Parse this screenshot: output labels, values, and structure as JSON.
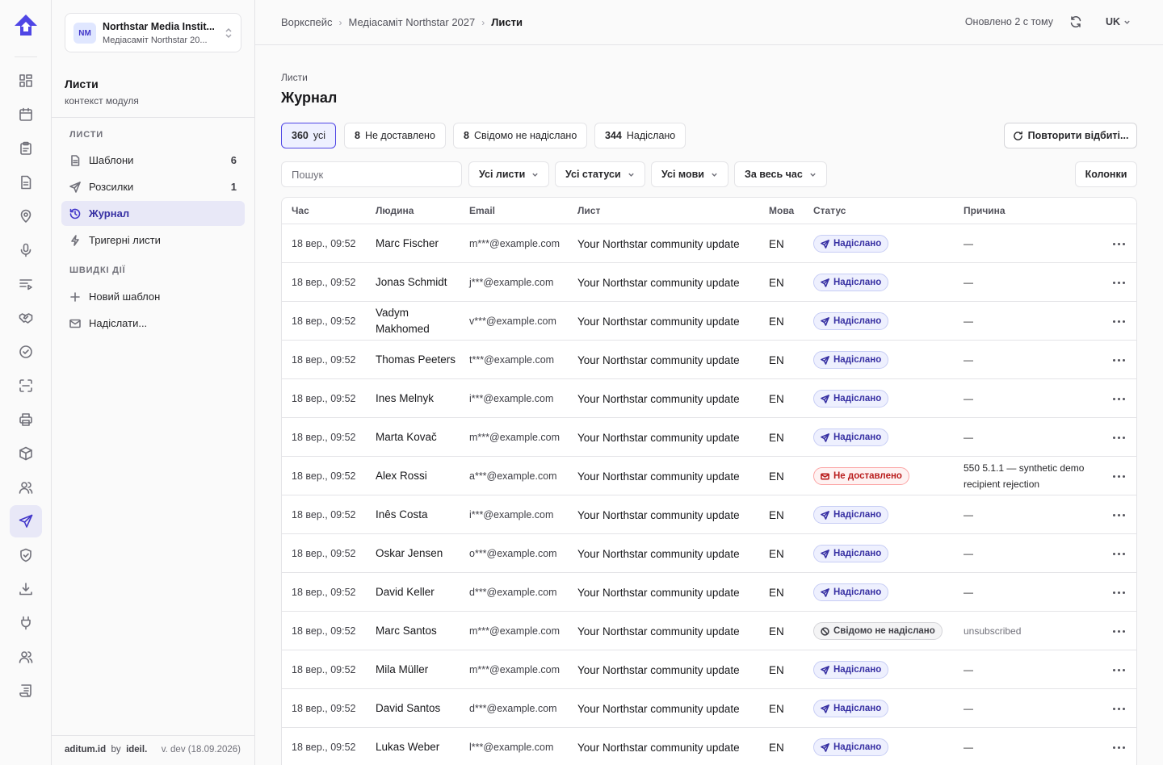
{
  "topbar": {
    "breadcrumbs": [
      "Воркспейс",
      "Медіасаміт Northstar 2027",
      "Листи"
    ],
    "updated": "Оновлено 2 с тому",
    "language": "UK"
  },
  "org": {
    "initials": "NM",
    "name": "Northstar Media Instit...",
    "event": "Медіасаміт Northstar 20..."
  },
  "module": {
    "title": "Листи",
    "subtitle": "контекст модуля"
  },
  "sidebar": {
    "section_letters": "ЛИСТИ",
    "items": [
      {
        "label": "Шаблони",
        "count": "6",
        "icon": "file-icon"
      },
      {
        "label": "Розсилки",
        "count": "1",
        "icon": "send-icon"
      },
      {
        "label": "Журнал",
        "count": "",
        "icon": "history-icon"
      },
      {
        "label": "Тригерні листи",
        "count": "",
        "icon": "bolt-icon"
      }
    ],
    "section_quick": "ШВИДКІ ДІЇ",
    "quick": [
      {
        "label": "Новий шаблон",
        "icon": "plus-icon"
      },
      {
        "label": "Надіслати...",
        "icon": "mail-icon"
      }
    ],
    "footer": {
      "brand": "aditum.id",
      "by": "by",
      "company": "ideil.",
      "version": "v. dev (18.09.2026)"
    }
  },
  "page": {
    "crumb": "Листи",
    "title": "Журнал",
    "filters": [
      {
        "count": "360",
        "label": "усі"
      },
      {
        "count": "8",
        "label": "Не доставлено"
      },
      {
        "count": "8",
        "label": "Свідомо не надіслано"
      },
      {
        "count": "344",
        "label": "Надіслано"
      }
    ],
    "retry_label": "Повторити відбиті...",
    "search_placeholder": "Пошук",
    "dropdowns": [
      "Усі листи",
      "Усі статуси",
      "Усі мови",
      "За весь час"
    ],
    "columns_label": "Колонки"
  },
  "table": {
    "headers": [
      "Час",
      "Людина",
      "Email",
      "Лист",
      "Мова",
      "Статус",
      "Причина"
    ],
    "rows": [
      {
        "time": "18 вер., 09:52",
        "person": "Marc Fischer",
        "email": "m***@example.com",
        "letter": "Your Northstar community update",
        "lang": "EN",
        "status": "Надіслано",
        "kind": "sent",
        "reason": "—"
      },
      {
        "time": "18 вер., 09:52",
        "person": "Jonas Schmidt",
        "email": "j***@example.com",
        "letter": "Your Northstar community update",
        "lang": "EN",
        "status": "Надіслано",
        "kind": "sent",
        "reason": "—"
      },
      {
        "time": "18 вер., 09:52",
        "person": "Vadym Makhomed",
        "email": "v***@example.com",
        "letter": "Your Northstar community update",
        "lang": "EN",
        "status": "Надіслано",
        "kind": "sent",
        "reason": "—"
      },
      {
        "time": "18 вер., 09:52",
        "person": "Thomas Peeters",
        "email": "t***@example.com",
        "letter": "Your Northstar community update",
        "lang": "EN",
        "status": "Надіслано",
        "kind": "sent",
        "reason": "—"
      },
      {
        "time": "18 вер., 09:52",
        "person": "Ines Melnyk",
        "email": "i***@example.com",
        "letter": "Your Northstar community update",
        "lang": "EN",
        "status": "Надіслано",
        "kind": "sent",
        "reason": "—"
      },
      {
        "time": "18 вер., 09:52",
        "person": "Marta Kovač",
        "email": "m***@example.com",
        "letter": "Your Northstar community update",
        "lang": "EN",
        "status": "Надіслано",
        "kind": "sent",
        "reason": "—"
      },
      {
        "time": "18 вер., 09:52",
        "person": "Alex Rossi",
        "email": "a***@example.com",
        "letter": "Your Northstar community update",
        "lang": "EN",
        "status": "Не доставлено",
        "kind": "fail",
        "reason": "550 5.1.1 — synthetic demo recipient rejection"
      },
      {
        "time": "18 вер., 09:52",
        "person": "Inês Costa",
        "email": "i***@example.com",
        "letter": "Your Northstar community update",
        "lang": "EN",
        "status": "Надіслано",
        "kind": "sent",
        "reason": "—"
      },
      {
        "time": "18 вер., 09:52",
        "person": "Oskar Jensen",
        "email": "o***@example.com",
        "letter": "Your Northstar community update",
        "lang": "EN",
        "status": "Надіслано",
        "kind": "sent",
        "reason": "—"
      },
      {
        "time": "18 вер., 09:52",
        "person": "David Keller",
        "email": "d***@example.com",
        "letter": "Your Northstar community update",
        "lang": "EN",
        "status": "Надіслано",
        "kind": "sent",
        "reason": "—"
      },
      {
        "time": "18 вер., 09:52",
        "person": "Marc Santos",
        "email": "m***@example.com",
        "letter": "Your Northstar community update",
        "lang": "EN",
        "status": "Свідомо не надіслано",
        "kind": "skip",
        "reason": "unsubscribed"
      },
      {
        "time": "18 вер., 09:52",
        "person": "Mila Müller",
        "email": "m***@example.com",
        "letter": "Your Northstar community update",
        "lang": "EN",
        "status": "Надіслано",
        "kind": "sent",
        "reason": "—"
      },
      {
        "time": "18 вер., 09:52",
        "person": "David Santos",
        "email": "d***@example.com",
        "letter": "Your Northstar community update",
        "lang": "EN",
        "status": "Надіслано",
        "kind": "sent",
        "reason": "—"
      },
      {
        "time": "18 вер., 09:52",
        "person": "Lukas Weber",
        "email": "l***@example.com",
        "letter": "Your Northstar community update",
        "lang": "EN",
        "status": "Надіслано",
        "kind": "sent",
        "reason": "—"
      }
    ]
  },
  "colors": {
    "accent": "#4338ca",
    "sent": "#3730a3",
    "fail": "#b91c1c",
    "skip": "#3f3f46"
  }
}
